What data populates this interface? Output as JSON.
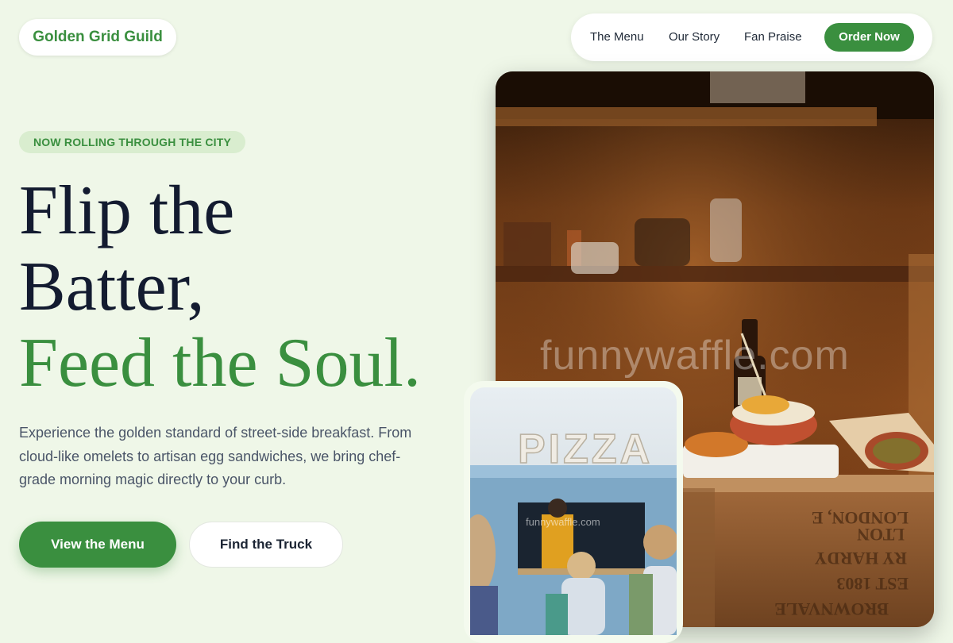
{
  "brand": {
    "name": "Golden Grid Guild"
  },
  "nav": {
    "links": [
      "The Menu",
      "Our Story",
      "Fan Praise"
    ],
    "cta": "Order Now"
  },
  "hero": {
    "badge": "NOW ROLLING THROUGH THE CITY",
    "headline": {
      "line1": "Flip the",
      "line2": "Batter,",
      "line3": "Feed the Soul."
    },
    "description": "Experience the golden standard of street-side breakfast. From cloud-like omelets to artisan egg sandwiches, we bring chef-grade morning magic directly to your curb.",
    "primary_button": "View the Menu",
    "secondary_button": "Find the Truck"
  },
  "images": {
    "main_watermark": "funnywaffle.com",
    "truck_watermark": "funnywaffle.com",
    "truck_sign": "PIZZA",
    "crate_text": [
      "LONDON, E",
      "LTON",
      "RY HARDY",
      "EST 1803",
      "BROWNVALE"
    ]
  },
  "colors": {
    "accent": "#3a8f3f",
    "background": "#eff7e8",
    "headline": "#131b30"
  }
}
